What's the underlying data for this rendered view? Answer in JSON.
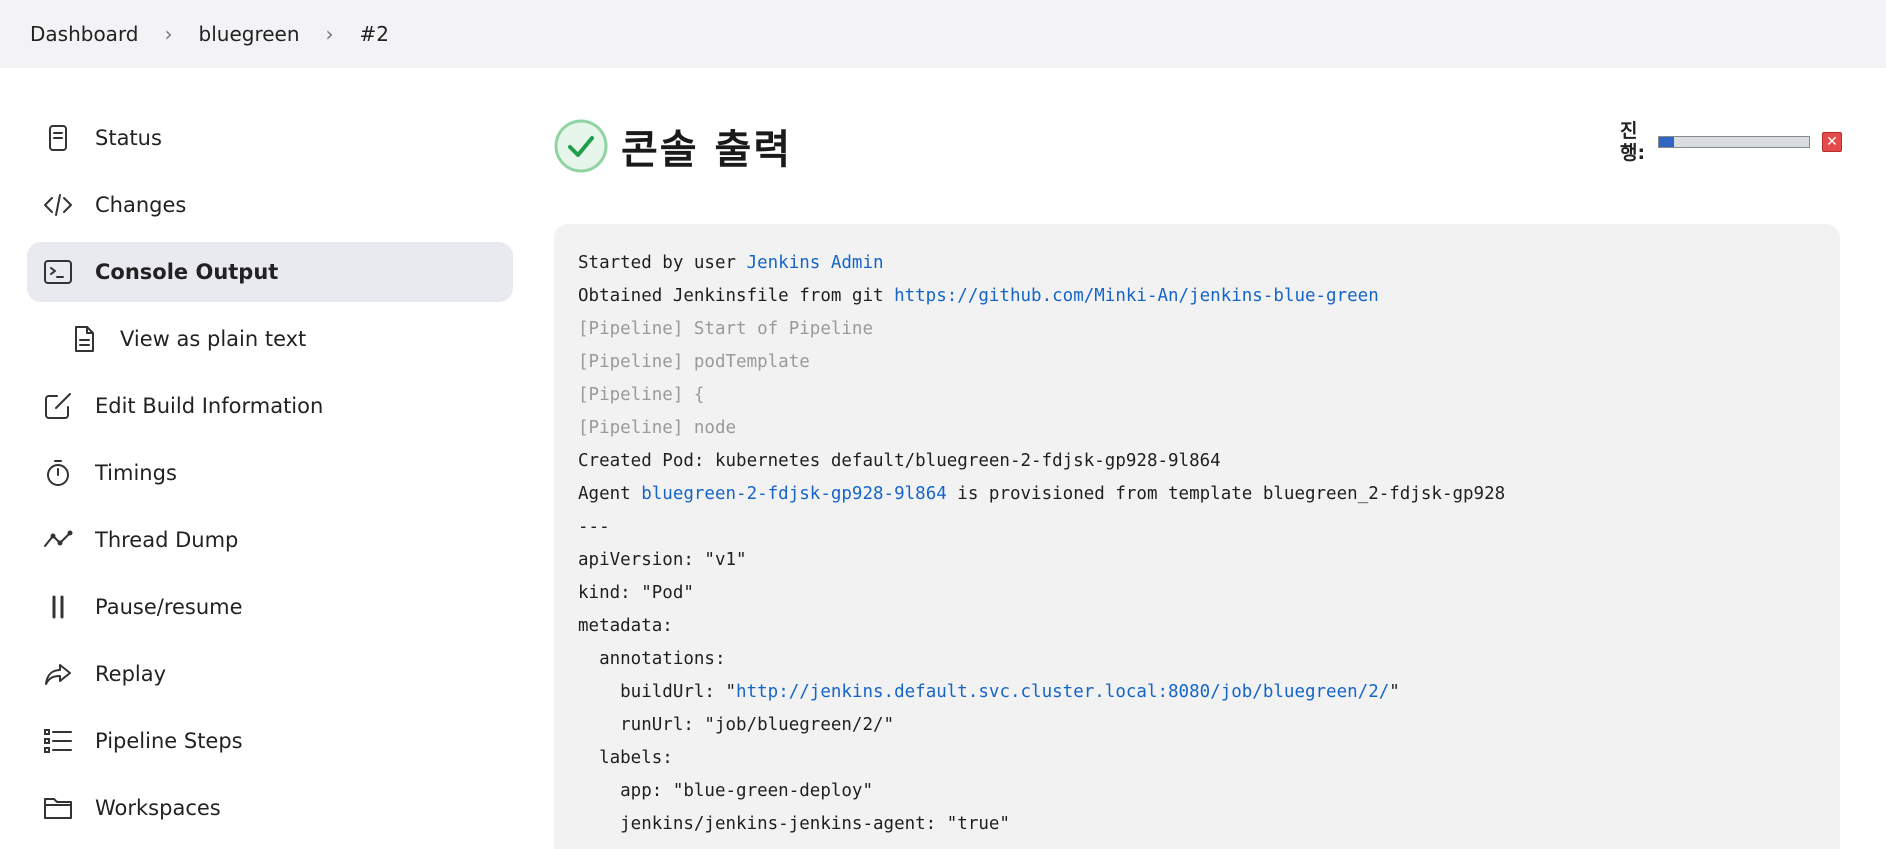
{
  "breadcrumb": {
    "items": [
      "Dashboard",
      "bluegreen",
      "#2"
    ]
  },
  "sidebar": {
    "items": [
      {
        "label": "Status",
        "icon": "document-icon"
      },
      {
        "label": "Changes",
        "icon": "code-icon"
      },
      {
        "label": "Console Output",
        "icon": "terminal-icon",
        "active": true
      },
      {
        "label": "View as plain text",
        "icon": "file-text-icon"
      },
      {
        "label": "Edit Build Information",
        "icon": "edit-icon"
      },
      {
        "label": "Timings",
        "icon": "stopwatch-icon"
      },
      {
        "label": "Thread Dump",
        "icon": "activity-icon"
      },
      {
        "label": "Pause/resume",
        "icon": "pause-icon"
      },
      {
        "label": "Replay",
        "icon": "replay-icon"
      },
      {
        "label": "Pipeline Steps",
        "icon": "list-icon"
      },
      {
        "label": "Workspaces",
        "icon": "folder-icon"
      }
    ]
  },
  "header": {
    "title": "콘솔 출력",
    "status_icon": "success-check-icon"
  },
  "progress": {
    "label": "진행:",
    "value": 0.1
  },
  "console": {
    "lines": [
      {
        "dim": false,
        "parts": [
          {
            "text": "Started by user "
          },
          {
            "text": "Jenkins Admin",
            "link": true
          }
        ]
      },
      {
        "dim": false,
        "parts": [
          {
            "text": "Obtained Jenkinsfile from git "
          },
          {
            "text": "https://github.com/Minki-An/jenkins-blue-green",
            "link": true
          }
        ]
      },
      {
        "dim": true,
        "parts": [
          {
            "text": "[Pipeline] Start of Pipeline"
          }
        ]
      },
      {
        "dim": true,
        "parts": [
          {
            "text": "[Pipeline] podTemplate"
          }
        ]
      },
      {
        "dim": true,
        "parts": [
          {
            "text": "[Pipeline] {"
          }
        ]
      },
      {
        "dim": true,
        "parts": [
          {
            "text": "[Pipeline] node"
          }
        ]
      },
      {
        "dim": false,
        "parts": [
          {
            "text": "Created Pod: kubernetes default/bluegreen-2-fdjsk-gp928-9l864"
          }
        ]
      },
      {
        "dim": false,
        "parts": [
          {
            "text": "Agent "
          },
          {
            "text": "bluegreen-2-fdjsk-gp928-9l864",
            "link": true
          },
          {
            "text": " is provisioned from template bluegreen_2-fdjsk-gp928"
          }
        ]
      },
      {
        "dim": false,
        "parts": [
          {
            "text": "---"
          }
        ]
      },
      {
        "dim": false,
        "parts": [
          {
            "text": "apiVersion: \"v1\""
          }
        ]
      },
      {
        "dim": false,
        "parts": [
          {
            "text": "kind: \"Pod\""
          }
        ]
      },
      {
        "dim": false,
        "parts": [
          {
            "text": "metadata:"
          }
        ]
      },
      {
        "dim": false,
        "parts": [
          {
            "text": "  annotations:"
          }
        ]
      },
      {
        "dim": false,
        "parts": [
          {
            "text": "    buildUrl: \""
          },
          {
            "text": "http://jenkins.default.svc.cluster.local:8080/job/bluegreen/2/",
            "link": true
          },
          {
            "text": "\""
          }
        ]
      },
      {
        "dim": false,
        "parts": [
          {
            "text": "    runUrl: \"job/bluegreen/2/\""
          }
        ]
      },
      {
        "dim": false,
        "parts": [
          {
            "text": "  labels:"
          }
        ]
      },
      {
        "dim": false,
        "parts": [
          {
            "text": "    app: \"blue-green-deploy\""
          }
        ]
      },
      {
        "dim": false,
        "parts": [
          {
            "text": "    jenkins/jenkins-jenkins-agent: \"true\""
          }
        ]
      }
    ]
  },
  "colors": {
    "link": "#1565c9",
    "success": "#1e9e4a",
    "breadcrumb_bg": "#f3f3f6",
    "console_bg": "#f2f2f2",
    "active_item_bg": "#e9eaef"
  }
}
